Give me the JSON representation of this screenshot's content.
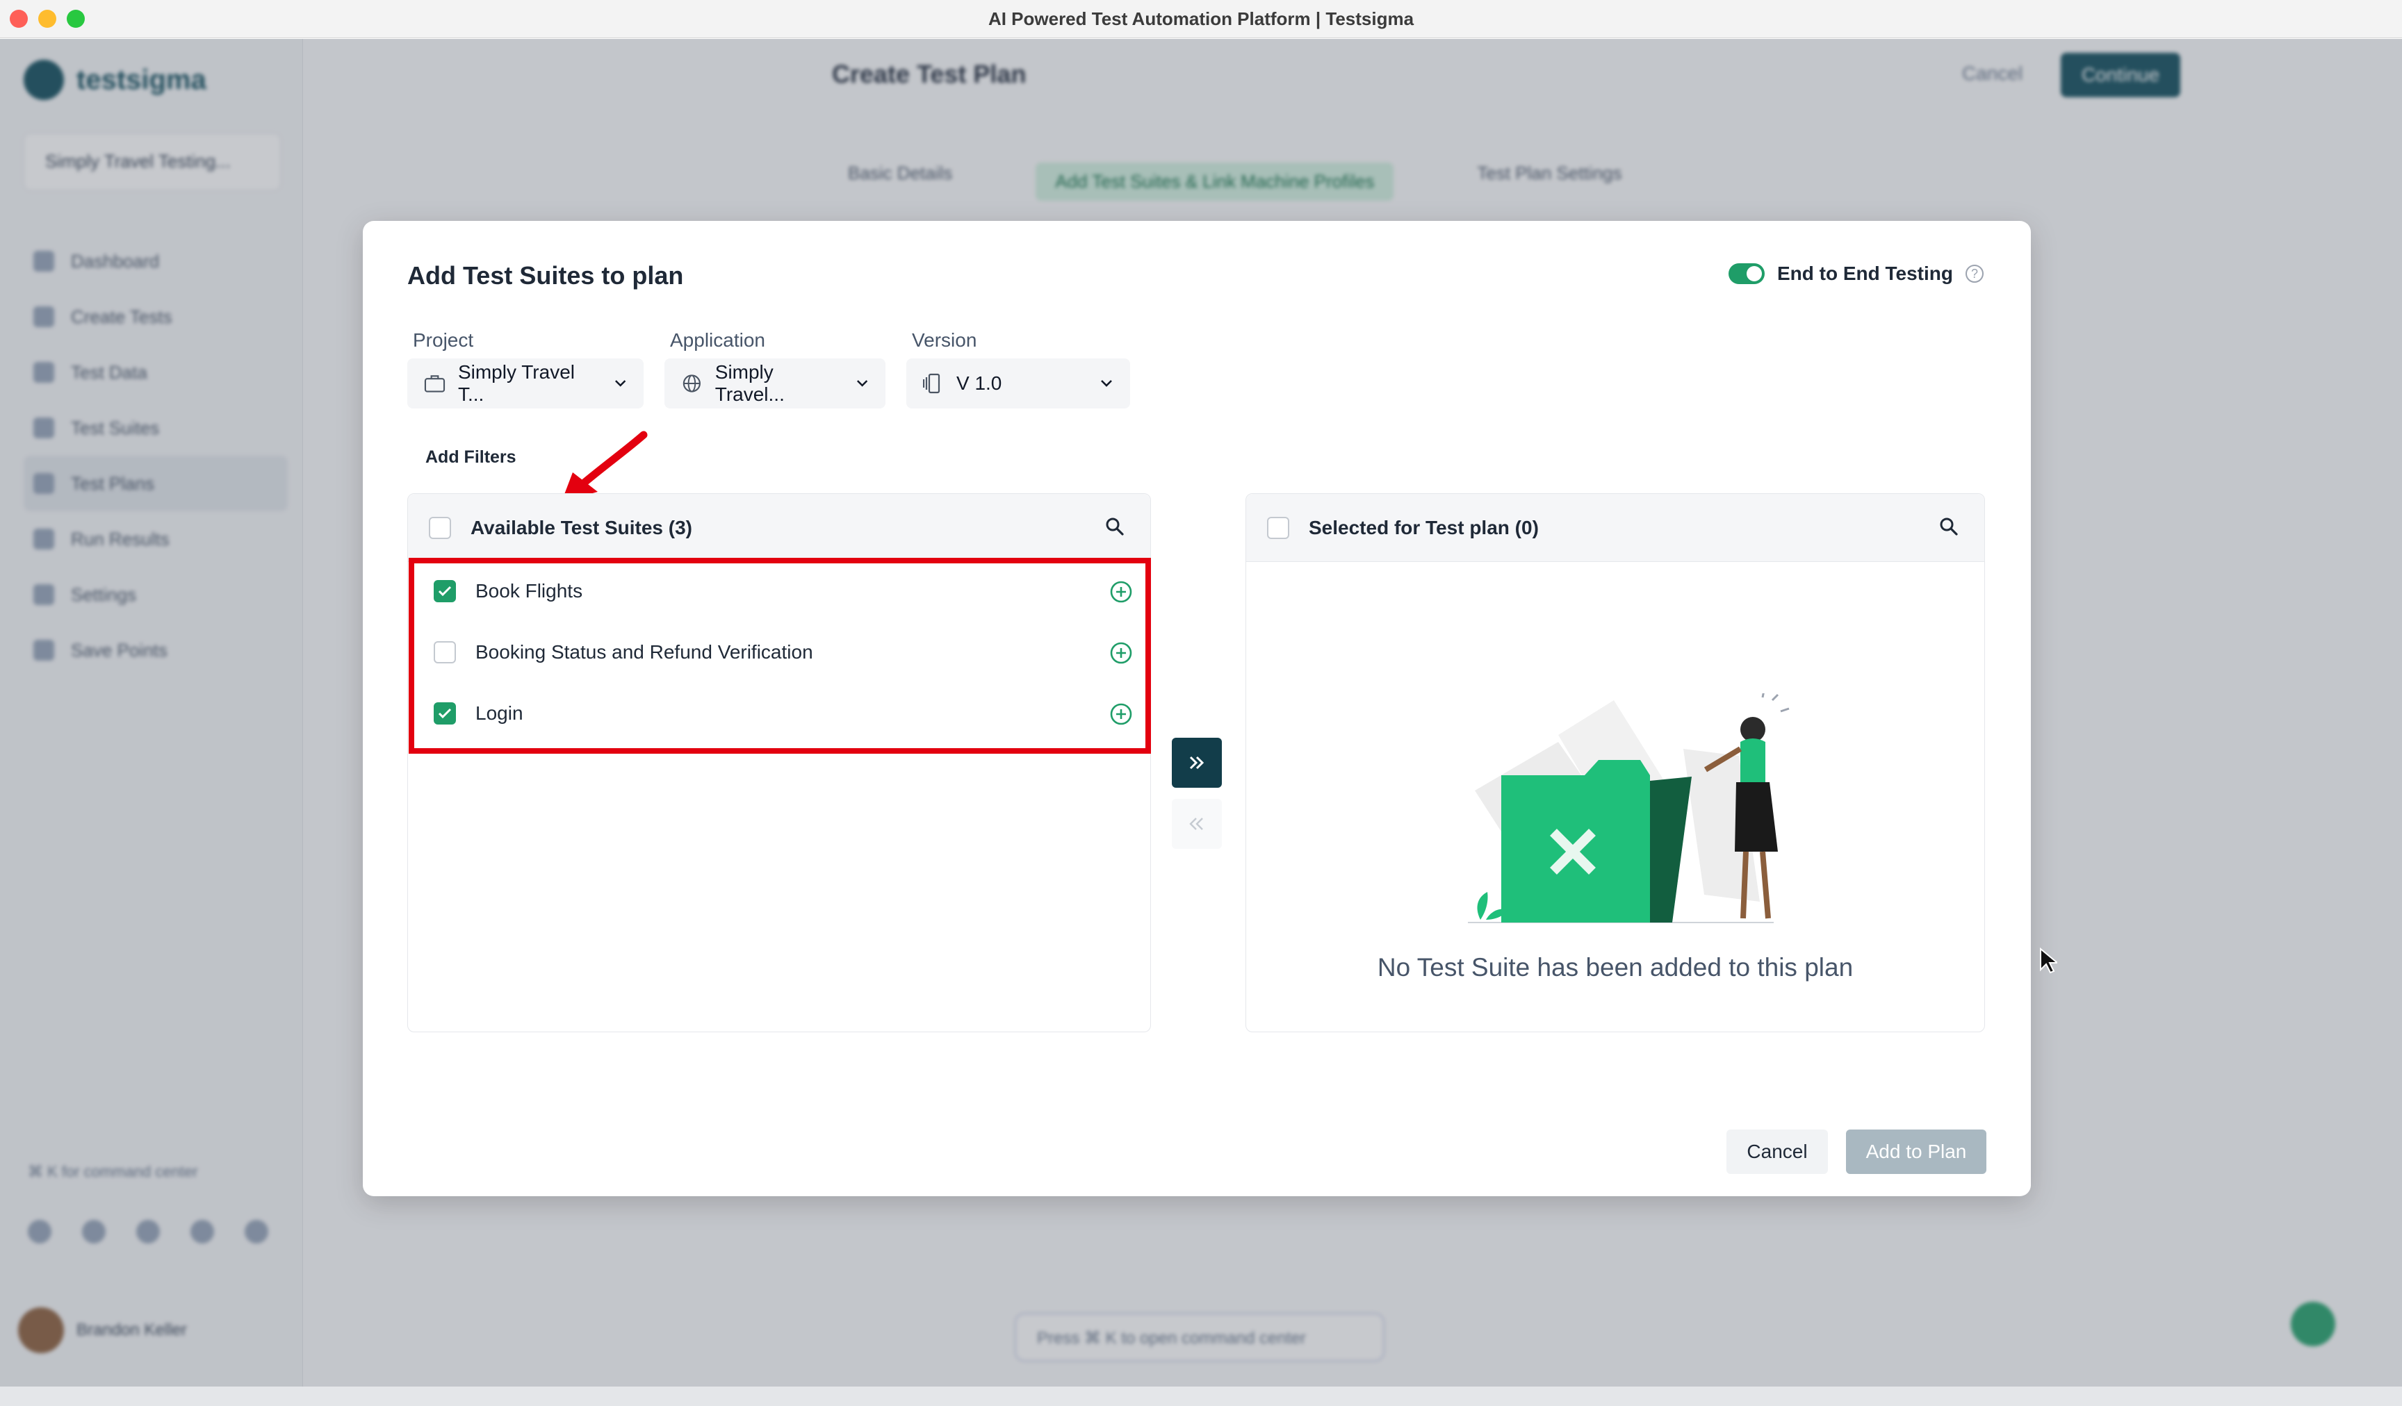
{
  "window": {
    "title": "AI Powered Test Automation Platform | Testsigma"
  },
  "background": {
    "logo_text": "testsigma",
    "project_switch": "Simply Travel Testing...",
    "nav": [
      "Dashboard",
      "Create Tests",
      "Test Data",
      "Test Suites",
      "Test Plans",
      "Run Results",
      "Settings",
      "Save Points"
    ],
    "footer_hint": "⌘ K  for command center",
    "user_name": "Brandon Keller",
    "plan_title": "Create Test Plan",
    "cancel": "Cancel",
    "continue": "Continue",
    "steps": [
      "Basic Details",
      "Add Test Suites & Link Machine Profiles",
      "Test Plan Settings"
    ],
    "command_hint": "Press ⌘ K to open command center"
  },
  "modal": {
    "title": "Add Test Suites to plan",
    "e2e_label": "End to End Testing",
    "e2e_enabled": true,
    "project": {
      "label": "Project",
      "value": "Simply Travel T..."
    },
    "application": {
      "label": "Application",
      "value": "Simply Travel..."
    },
    "version": {
      "label": "Version",
      "value": "V 1.0"
    },
    "add_filters": "Add Filters",
    "available": {
      "title": "Available Test Suites (3)",
      "items": [
        {
          "name": "Book Flights",
          "checked": true
        },
        {
          "name": "Booking Status and Refund Verification",
          "checked": false
        },
        {
          "name": "Login",
          "checked": true
        }
      ]
    },
    "selected": {
      "title": "Selected for Test plan (0)",
      "empty_text": "No Test Suite has been added to this plan"
    },
    "cancel_label": "Cancel",
    "add_label": "Add to Plan"
  },
  "colors": {
    "accent_green": "#1f9d68",
    "dark_teal": "#123d4a",
    "annotation_red": "#e3000f"
  }
}
